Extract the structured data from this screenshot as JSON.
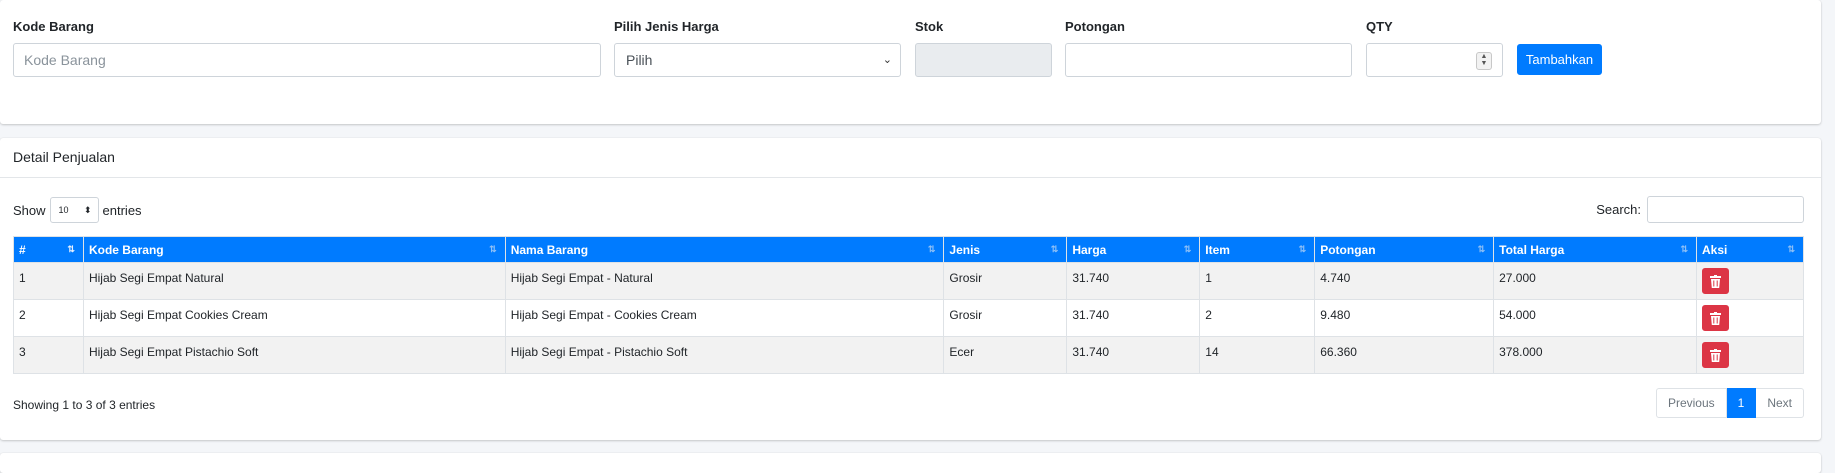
{
  "form": {
    "kode_barang": {
      "label": "Kode Barang",
      "placeholder": "Kode Barang",
      "value": ""
    },
    "jenis_harga": {
      "label": "Pilih Jenis Harga",
      "selected": "Pilih"
    },
    "stok": {
      "label": "Stok",
      "value": ""
    },
    "potongan": {
      "label": "Potongan",
      "value": ""
    },
    "qty": {
      "label": "QTY",
      "value": ""
    },
    "submit_label": "Tambahkan"
  },
  "detail": {
    "title": "Detail Penjualan",
    "show_label": "Show",
    "entries_label": "entries",
    "page_length": "10",
    "search_label": "Search:",
    "columns": [
      "#",
      "Kode Barang",
      "Nama Barang",
      "Jenis",
      "Harga",
      "Item",
      "Potongan",
      "Total Harga",
      "Aksi"
    ],
    "rows": [
      {
        "no": "1",
        "kode": "Hijab Segi Empat Natural",
        "nama": "Hijab Segi Empat - Natural",
        "jenis": "Grosir",
        "harga": "31.740",
        "item": "1",
        "potongan": "4.740",
        "total": "27.000"
      },
      {
        "no": "2",
        "kode": "Hijab Segi Empat Cookies Cream",
        "nama": "Hijab Segi Empat - Cookies Cream",
        "jenis": "Grosir",
        "harga": "31.740",
        "item": "2",
        "potongan": "9.480",
        "total": "54.000"
      },
      {
        "no": "3",
        "kode": "Hijab Segi Empat Pistachio Soft",
        "nama": "Hijab Segi Empat - Pistachio Soft",
        "jenis": "Ecer",
        "harga": "31.740",
        "item": "14",
        "potongan": "66.360",
        "total": "378.000"
      }
    ],
    "info": "Showing 1 to 3 of 3 entries",
    "pagination": {
      "previous": "Previous",
      "current": "1",
      "next": "Next"
    }
  },
  "icons": {
    "delete": "trash-icon",
    "sort": "sort-arrows-icon",
    "select": "chevron-down-icon"
  },
  "colors": {
    "primary": "#007bff",
    "danger": "#dc3545",
    "background": "#f4f6f9"
  }
}
